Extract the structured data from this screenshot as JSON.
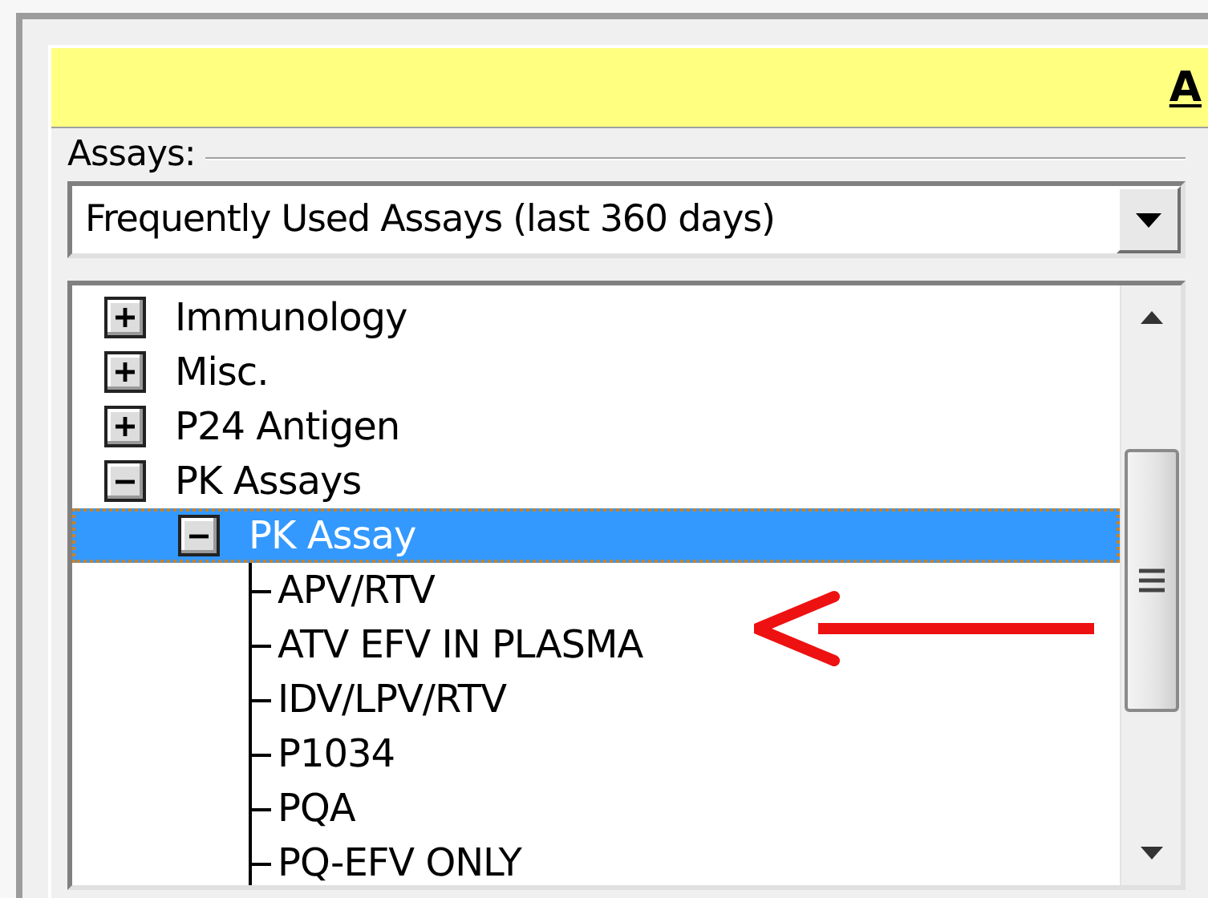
{
  "header": {
    "title": "A"
  },
  "assays": {
    "label": "Assays:",
    "dropdown": {
      "value": "Frequently Used Assays (last 360 days)"
    }
  },
  "tree": [
    {
      "label": "Immunology",
      "expanded": false,
      "selected": false
    },
    {
      "label": "Misc.",
      "expanded": false,
      "selected": false
    },
    {
      "label": "P24 Antigen",
      "expanded": false,
      "selected": false
    },
    {
      "label": "PK Assays",
      "expanded": true,
      "selected": false,
      "children": [
        {
          "label": "PK Assay",
          "expanded": true,
          "selected": true,
          "children": [
            {
              "label": "APV/RTV",
              "selected": false
            },
            {
              "label": "ATV EFV IN PLASMA",
              "selected": false
            },
            {
              "label": "IDV/LPV/RTV",
              "selected": false
            },
            {
              "label": "P1034",
              "selected": false
            },
            {
              "label": "PQA",
              "selected": false
            },
            {
              "label": "PQ-EFV ONLY",
              "selected": false
            }
          ]
        }
      ]
    }
  ]
}
